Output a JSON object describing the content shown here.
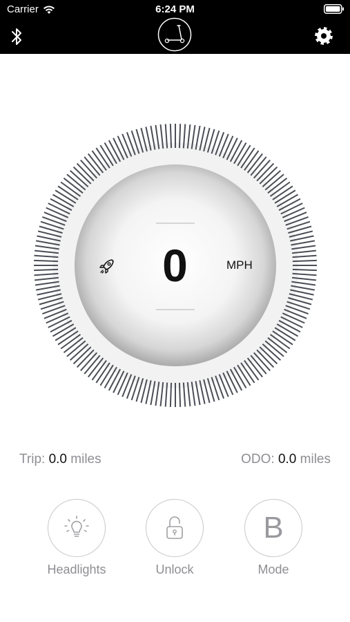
{
  "status_bar": {
    "carrier": "Carrier",
    "time": "6:24 PM"
  },
  "nav": {
    "bluetooth_icon": "bluetooth-icon",
    "logo_icon": "scooter-logo-icon",
    "settings_icon": "gear-icon"
  },
  "speedometer": {
    "speed": "0",
    "unit": "MPH",
    "mode_icon": "rocket-icon"
  },
  "stats": {
    "trip_label": "Trip:",
    "trip_value": "0.0",
    "trip_unit": "miles",
    "odo_label": "ODO:",
    "odo_value": "0.0",
    "odo_unit": "miles"
  },
  "controls": {
    "headlights_label": "Headlights",
    "unlock_label": "Unlock",
    "mode_label": "Mode",
    "mode_value": "B"
  },
  "colors": {
    "topbar": "#000000",
    "tick": "#4a4d55",
    "muted_text": "#8e8e93",
    "primary_text": "#111111"
  }
}
